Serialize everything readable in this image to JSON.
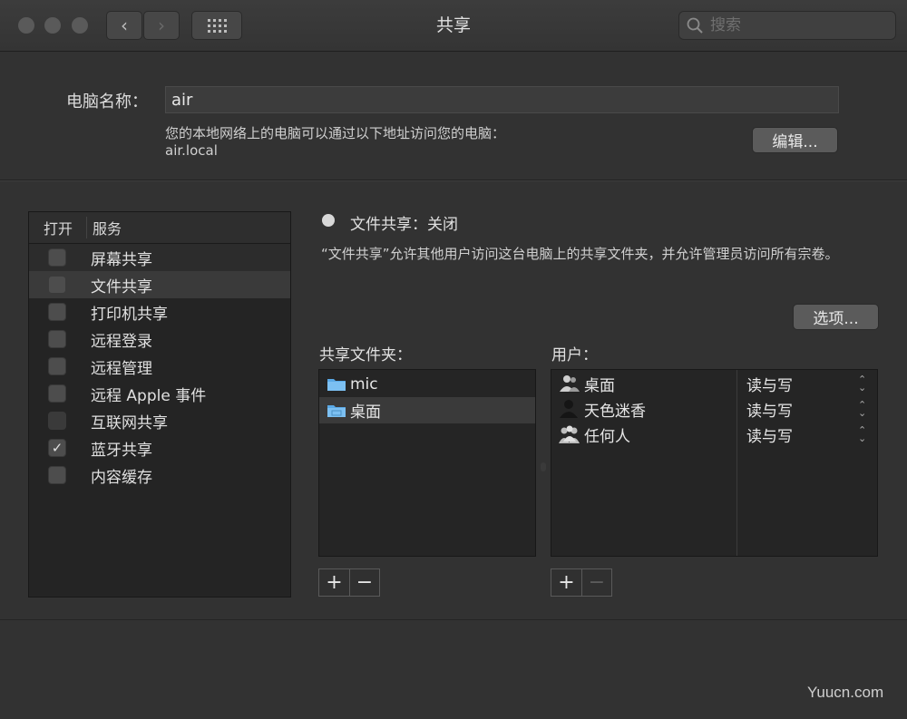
{
  "window": {
    "title": "共享",
    "search_placeholder": "搜索"
  },
  "computer": {
    "name_label": "电脑名称：",
    "name_value": "air",
    "address_note": "您的本地网络上的电脑可以通过以下地址访问您的电脑：",
    "address": "air.local",
    "edit_label": "编辑..."
  },
  "services": {
    "header_open": "打开",
    "header_service": "服务",
    "items": [
      {
        "label": "屏幕共享",
        "checked": false
      },
      {
        "label": "文件共享",
        "checked": false
      },
      {
        "label": "打印机共享",
        "checked": false
      },
      {
        "label": "远程登录",
        "checked": false
      },
      {
        "label": "远程管理",
        "checked": false
      },
      {
        "label": "远程 Apple 事件",
        "checked": false
      },
      {
        "label": "互联网共享",
        "checked": false
      },
      {
        "label": "蓝牙共享",
        "checked": true
      },
      {
        "label": "内容缓存",
        "checked": false
      }
    ],
    "check_mark": "✓"
  },
  "detail": {
    "status": "文件共享：关闭",
    "description": "“文件共享”允许其他用户访问这台电脑上的共享文件夹，并允许管理员访问所有宗卷。",
    "options_label": "选项...",
    "folders_label": "共享文件夹：",
    "users_label": "用户：",
    "folders": [
      "mic",
      "桌面"
    ],
    "users": [
      {
        "name": "桌面",
        "permission": "读与写"
      },
      {
        "name": "天色迷香",
        "permission": "读与写"
      },
      {
        "name": "任何人",
        "permission": "读与写"
      }
    ],
    "add_label": "+",
    "remove_label": "−"
  },
  "watermark": "Yuucn.com"
}
